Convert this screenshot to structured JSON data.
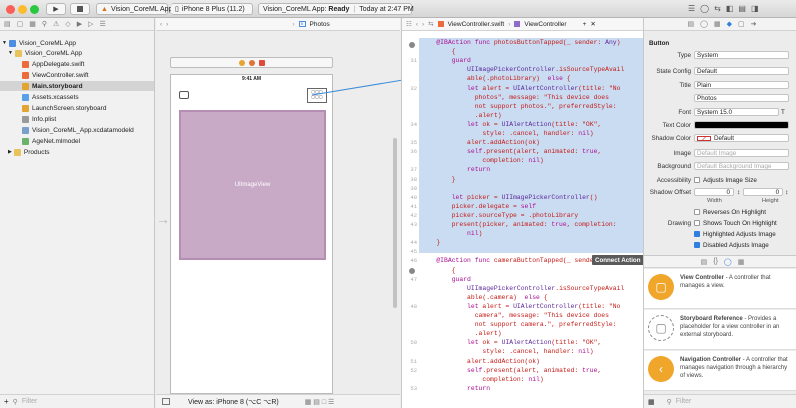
{
  "toolbar": {
    "scheme": "Vision_CoreML App",
    "device": "iPhone 8 Plus (11.2)",
    "status_app": "Vision_CoreML App:",
    "status_state": "Ready",
    "status_time": "Today at 2:47 PM"
  },
  "navigator": {
    "items": [
      {
        "label": "Vision_CoreML App"
      },
      {
        "label": "Vision_CoreML App"
      },
      {
        "label": "AppDelegate.swift"
      },
      {
        "label": "ViewController.swift"
      },
      {
        "label": "Main.storyboard"
      },
      {
        "label": "Assets.xcassets"
      },
      {
        "label": "LaunchScreen.storyboard"
      },
      {
        "label": "Info.plist"
      },
      {
        "label": "Vision_CoreML_App.xcdatamodeld"
      },
      {
        "label": "AgeNet.mlmodel"
      },
      {
        "label": "Products"
      }
    ],
    "filter_placeholder": "Filter"
  },
  "canvas": {
    "jump_photos": "Photos",
    "time": "9:41 AM",
    "imageview_label": "UIImageView",
    "view_as": "View as: iPhone 8 (⌥C ⌥R)"
  },
  "code": {
    "jump_file": "ViewController.swift",
    "jump_class": "ViewController",
    "connect_tooltip": "Connect Action",
    "lines": [
      {
        "n": "",
        "t": "    @IBAction func photosButtonTapped(_ sender: Any)"
      },
      {
        "n": "",
        "t": "        {"
      },
      {
        "n": "31",
        "t": "        guard"
      },
      {
        "n": "",
        "t": "            UIImagePickerController.isSourceTypeAvail"
      },
      {
        "n": "",
        "t": "            able(.photoLibrary)  else {"
      },
      {
        "n": "32",
        "t": "            let alert = UIAlertController(title: \"No"
      },
      {
        "n": "",
        "t": "              photos\", message: \"This device does"
      },
      {
        "n": "",
        "t": "              not support photos.\", preferredStyle:"
      },
      {
        "n": "",
        "t": "              .alert)"
      },
      {
        "n": "34",
        "t": "            let ok = UIAlertAction(title: \"OK\","
      },
      {
        "n": "",
        "t": "                style: .cancel, handler: nil)"
      },
      {
        "n": "35",
        "t": "            alert.addAction(ok)"
      },
      {
        "n": "36",
        "t": "            self.present(alert, animated: true,"
      },
      {
        "n": "",
        "t": "                completion: nil)"
      },
      {
        "n": "37",
        "t": "            return"
      },
      {
        "n": "38",
        "t": "        }"
      },
      {
        "n": "39",
        "t": ""
      },
      {
        "n": "40",
        "t": "        let picker = UIImagePickerController()"
      },
      {
        "n": "41",
        "t": "        picker.delegate = self"
      },
      {
        "n": "42",
        "t": "        picker.sourceType = .photoLibrary"
      },
      {
        "n": "43",
        "t": "        present(picker, animated: true, completion:"
      },
      {
        "n": "",
        "t": "            nil)"
      },
      {
        "n": "44",
        "t": "    }"
      },
      {
        "n": "45",
        "t": ""
      },
      {
        "n": "46",
        "t": "    @IBAction func cameraButtonTapped(_ sender: Any)"
      },
      {
        "n": "",
        "t": "        {"
      },
      {
        "n": "47",
        "t": "        guard"
      },
      {
        "n": "",
        "t": "            UIImagePickerController.isSourceTypeAvail"
      },
      {
        "n": "",
        "t": "            able(.camera)  else {"
      },
      {
        "n": "48",
        "t": "            let alert = UIAlertController(title: \"No"
      },
      {
        "n": "",
        "t": "              camera\", message: \"This device does"
      },
      {
        "n": "",
        "t": "              not support camera.\", preferredStyle:"
      },
      {
        "n": "",
        "t": "              .alert)"
      },
      {
        "n": "50",
        "t": "            let ok = UIAlertAction(title: \"OK\","
      },
      {
        "n": "",
        "t": "                style: .cancel, handler: nil)"
      },
      {
        "n": "51",
        "t": "            alert.addAction(ok)"
      },
      {
        "n": "52",
        "t": "            self.present(alert, animated: true,"
      },
      {
        "n": "",
        "t": "                completion: nil)"
      },
      {
        "n": "53",
        "t": "            return"
      }
    ]
  },
  "inspector": {
    "section": "Button",
    "rows": [
      {
        "label": "Type",
        "value": "System"
      },
      {
        "label": "State Config",
        "value": "Default"
      },
      {
        "label": "Title",
        "value": "Plain"
      },
      {
        "label": "",
        "value": "Photos"
      },
      {
        "label": "Font",
        "value": "System 15.0"
      },
      {
        "label": "Text Color",
        "value": ""
      },
      {
        "label": "Shadow Color",
        "value": "Default"
      },
      {
        "label": "Image",
        "value": "Default Image"
      },
      {
        "label": "Background",
        "value": "Default Background Image"
      }
    ],
    "accessibility_label": "Accessibility",
    "adjusts_image_size": "Adjusts Image Size",
    "shadow_offset_label": "Shadow Offset",
    "shadow_offset_w": "0",
    "shadow_offset_h": "0",
    "width_label": "Width",
    "height_label": "Height",
    "reverses_label": "Reverses On Highlight",
    "drawing_label": "Drawing",
    "shows_touch": "Shows Touch On Highlight",
    "highlighted_adjusts": "Highlighted Adjusts Image",
    "disabled_adjusts": "Disabled Adjusts Image",
    "library": [
      {
        "title": "View Controller",
        "desc": " - A controller that manages a view."
      },
      {
        "title": "Storyboard Reference",
        "desc": " - Provides a placeholder for a view controller in an external storyboard."
      },
      {
        "title": "Navigation Controller",
        "desc": " - A controller that manages navigation through a hierarchy of views."
      }
    ],
    "filter_placeholder": "Filter"
  },
  "colors": {
    "selection_blue": "#c9dcf2",
    "image_view": "#c8a9c6",
    "accent": "#2f7fe0"
  }
}
